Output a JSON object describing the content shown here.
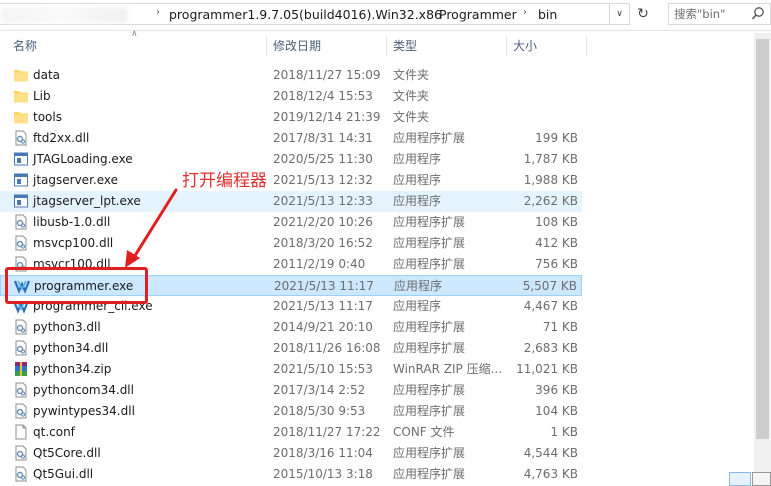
{
  "address": {
    "crumbs": [
      "programmer1.9.7.05(build4016).Win32.x86",
      "Programmer",
      "bin"
    ],
    "search_placeholder": "搜索\"bin\""
  },
  "columns": {
    "name": "名称",
    "date": "修改日期",
    "type": "类型",
    "size": "大小"
  },
  "annotation": {
    "text": "打开编程器"
  },
  "files": [
    {
      "name": "data",
      "date": "2018/11/27 15:09",
      "type": "文件夹",
      "size": "",
      "icon": "folder-icon"
    },
    {
      "name": "Lib",
      "date": "2018/12/4 15:53",
      "type": "文件夹",
      "size": "",
      "icon": "folder-icon"
    },
    {
      "name": "tools",
      "date": "2019/12/14 21:39",
      "type": "文件夹",
      "size": "",
      "icon": "folder-icon"
    },
    {
      "name": "ftd2xx.dll",
      "date": "2017/8/31 14:31",
      "type": "应用程序扩展",
      "size": "199 KB",
      "icon": "dll-icon"
    },
    {
      "name": "JTAGLoading.exe",
      "date": "2020/5/25 11:30",
      "type": "应用程序",
      "size": "1,787 KB",
      "icon": "exe-icon"
    },
    {
      "name": "jtagserver.exe",
      "date": "2021/5/13 12:32",
      "type": "应用程序",
      "size": "1,988 KB",
      "icon": "exe-icon"
    },
    {
      "name": "jtagserver_lpt.exe",
      "date": "2021/5/13 12:33",
      "type": "应用程序",
      "size": "2,262 KB",
      "icon": "exe-icon"
    },
    {
      "name": "libusb-1.0.dll",
      "date": "2021/2/20 10:26",
      "type": "应用程序扩展",
      "size": "108 KB",
      "icon": "dll-icon"
    },
    {
      "name": "msvcp100.dll",
      "date": "2018/3/20 16:52",
      "type": "应用程序扩展",
      "size": "412 KB",
      "icon": "dll-icon"
    },
    {
      "name": "msvcr100.dll",
      "date": "2011/2/19 0:40",
      "type": "应用程序扩展",
      "size": "756 KB",
      "icon": "dll-icon"
    },
    {
      "name": "programmer.exe",
      "date": "2021/5/13 11:17",
      "type": "应用程序",
      "size": "5,507 KB",
      "icon": "programmer-app-icon"
    },
    {
      "name": "programmer_cli.exe",
      "date": "2021/5/13 11:17",
      "type": "应用程序",
      "size": "4,467 KB",
      "icon": "programmer-app-icon"
    },
    {
      "name": "python3.dll",
      "date": "2014/9/21 20:10",
      "type": "应用程序扩展",
      "size": "71 KB",
      "icon": "dll-icon"
    },
    {
      "name": "python34.dll",
      "date": "2018/11/26 16:08",
      "type": "应用程序扩展",
      "size": "2,683 KB",
      "icon": "dll-icon"
    },
    {
      "name": "python34.zip",
      "date": "2021/5/10 15:53",
      "type": "WinRAR ZIP 压缩...",
      "size": "11,021 KB",
      "icon": "winrar-icon"
    },
    {
      "name": "pythoncom34.dll",
      "date": "2017/3/14 2:52",
      "type": "应用程序扩展",
      "size": "396 KB",
      "icon": "dll-icon"
    },
    {
      "name": "pywintypes34.dll",
      "date": "2018/5/30 9:53",
      "type": "应用程序扩展",
      "size": "104 KB",
      "icon": "dll-icon"
    },
    {
      "name": "qt.conf",
      "date": "2018/11/27 17:22",
      "type": "CONF 文件",
      "size": "1 KB",
      "icon": "file-icon"
    },
    {
      "name": "Qt5Core.dll",
      "date": "2018/3/16 11:04",
      "type": "应用程序扩展",
      "size": "4,544 KB",
      "icon": "dll-icon"
    },
    {
      "name": "Qt5Gui.dll",
      "date": "2015/10/13 3:18",
      "type": "应用程序扩展",
      "size": "4,763 KB",
      "icon": "dll-icon"
    }
  ]
}
